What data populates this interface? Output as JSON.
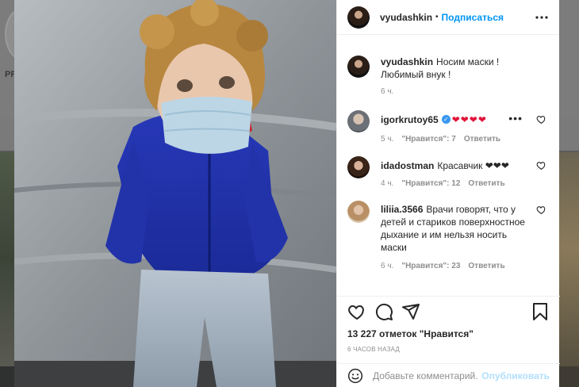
{
  "backdrop": {
    "profile_fragment": "PR"
  },
  "post": {
    "owner": "vyudashkin",
    "follow_label": "Подписаться",
    "separator": "•",
    "caption": "Носим маски ! Любимый внук !",
    "caption_time": "6 ч.",
    "likes": "13 227 отметок \"Нравится\"",
    "time_ago": "6 ЧАСОВ НАЗАД"
  },
  "comments": [
    {
      "user": "igorkrutoy65",
      "verified": true,
      "text": "❤❤❤❤",
      "time": "5 ч.",
      "likes": "\"Нравится\": 7",
      "reply": "Ответить"
    },
    {
      "user": "idadostman",
      "verified": false,
      "text": "Красавчик ❤❤❤",
      "time": "4 ч.",
      "likes": "\"Нравится\": 12",
      "reply": "Ответить"
    },
    {
      "user": "liliia.3566",
      "verified": false,
      "text": "Врачи говорят, что у детей и стариков поверхностное дыхание и им нельзя носить маски",
      "time": "6 ч.",
      "likes": "\"Нравится\": 23",
      "reply": "Ответить"
    }
  ],
  "comment_more": "•••",
  "verified_mark": "✓",
  "add_comment": {
    "placeholder": "Добавьте комментарий...",
    "publish_label": "Опубликовать"
  },
  "icons": [
    "more-options-icon",
    "heart-icon",
    "comment-icon",
    "share-icon",
    "bookmark-icon",
    "emoji-icon",
    "verified-badge-icon"
  ],
  "colors": {
    "accent": "#0095f6",
    "heart": "#e0153a",
    "muted": "#8e8e8e",
    "publish_disabled": "#b2dffc"
  }
}
